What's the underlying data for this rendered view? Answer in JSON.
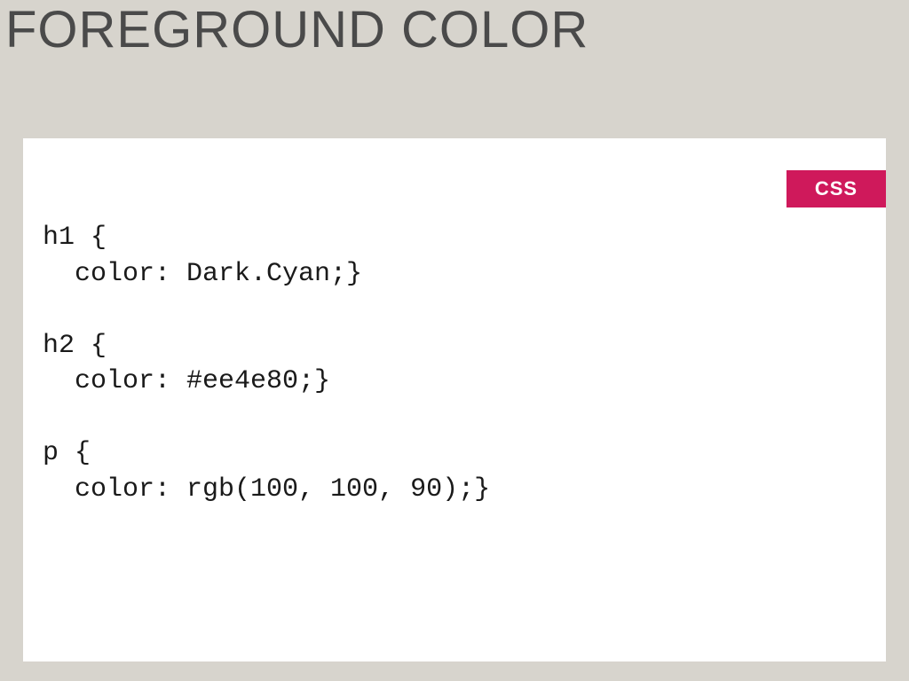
{
  "title": "FOREGROUND COLOR",
  "badge": "CSS",
  "code": "h1 {\n  color: Dark.Cyan;}\n\nh2 {\n  color: #ee4e80;}\n\np {\n  color: rgb(100, 100, 90);}"
}
